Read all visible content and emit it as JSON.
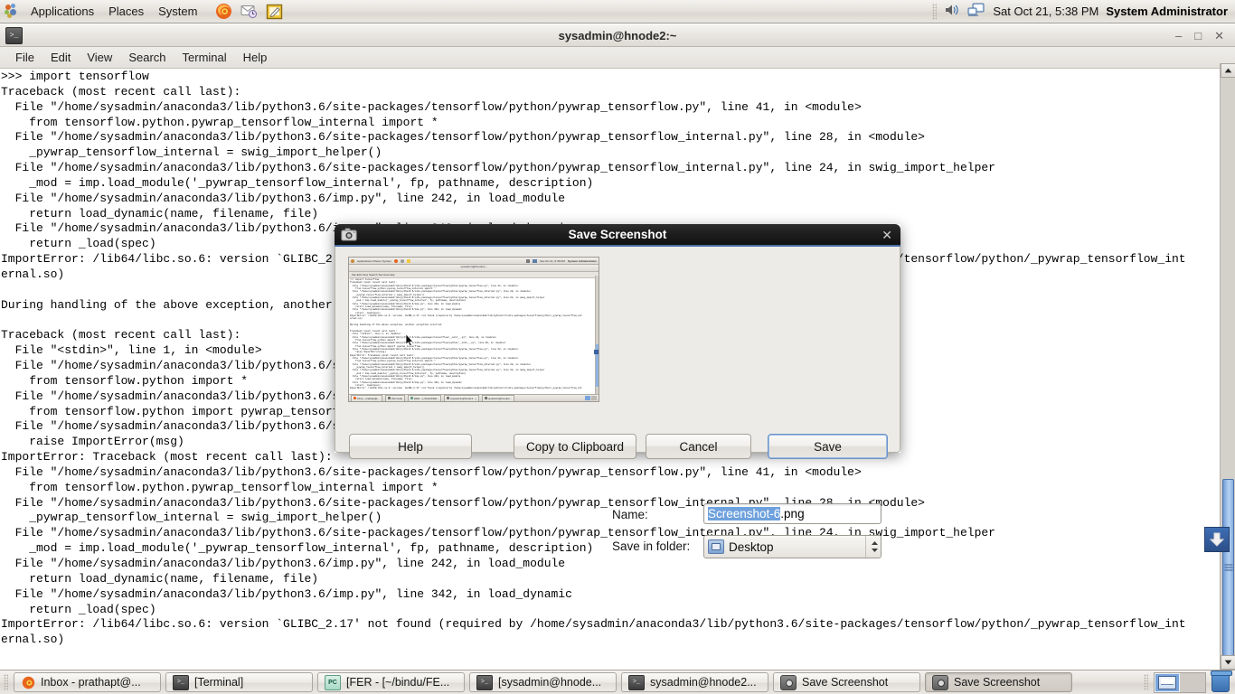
{
  "top_panel": {
    "menus": [
      "Applications",
      "Places",
      "System"
    ],
    "launchers": [
      {
        "name": "firefox-icon",
        "title": "Firefox Web Browser"
      },
      {
        "name": "evolution-mail-icon",
        "title": "Evolution Mail"
      },
      {
        "name": "text-editor-icon",
        "title": "Text Editor"
      }
    ],
    "tray": [
      {
        "name": "volume-icon"
      },
      {
        "name": "network-icon"
      }
    ],
    "clock": "Sat Oct 21,  5:38 PM",
    "user": "System Administrator"
  },
  "terminal": {
    "title": "sysadmin@hnode2:~",
    "menus": [
      "File",
      "Edit",
      "View",
      "Search",
      "Terminal",
      "Help"
    ],
    "window_buttons": {
      "minimize": "–",
      "maximize": "□",
      "close": "✕"
    },
    "content": ">>> import tensorflow\nTraceback (most recent call last):\n  File \"/home/sysadmin/anaconda3/lib/python3.6/site-packages/tensorflow/python/pywrap_tensorflow.py\", line 41, in <module>\n    from tensorflow.python.pywrap_tensorflow_internal import *\n  File \"/home/sysadmin/anaconda3/lib/python3.6/site-packages/tensorflow/python/pywrap_tensorflow_internal.py\", line 28, in <module>\n    _pywrap_tensorflow_internal = swig_import_helper()\n  File \"/home/sysadmin/anaconda3/lib/python3.6/site-packages/tensorflow/python/pywrap_tensorflow_internal.py\", line 24, in swig_import_helper\n    _mod = imp.load_module('_pywrap_tensorflow_internal', fp, pathname, description)\n  File \"/home/sysadmin/anaconda3/lib/python3.6/imp.py\", line 242, in load_module\n    return load_dynamic(name, filename, file)\n  File \"/home/sysadmin/anaconda3/lib/python3.6/imp.py\", line 342, in load_dynamic\n    return _load(spec)\nImportError: /lib64/libc.so.6: version `GLIBC_2.17' not found (required by /home/sysadmin/anaconda3/lib/python3.6/site-packages/tensorflow/python/_pywrap_tensorflow_int\nernal.so)\n\nDuring handling of the above exception, another exception occurred:\n\nTraceback (most recent call last):\n  File \"<stdin>\", line 1, in <module>\n  File \"/home/sysadmin/anaconda3/lib/python3.6/site-packages/tensorflow/__init__.py\", line 24, in <module>\n    from tensorflow.python import *\n  File \"/home/sysadmin/anaconda3/lib/python3.6/site-packages/tensorflow/python/__init__.py\", line 49, in <module>\n    from tensorflow.python import pywrap_tensorflow\n  File \"/home/sysadmin/anaconda3/lib/python3.6/site-packages/tensorflow/python/pywrap_tensorflow.py\", line 52, in <module>\n    raise ImportError(msg)\nImportError: Traceback (most recent call last):\n  File \"/home/sysadmin/anaconda3/lib/python3.6/site-packages/tensorflow/python/pywrap_tensorflow.py\", line 41, in <module>\n    from tensorflow.python.pywrap_tensorflow_internal import *\n  File \"/home/sysadmin/anaconda3/lib/python3.6/site-packages/tensorflow/python/pywrap_tensorflow_internal.py\", line 28, in <module>\n    _pywrap_tensorflow_internal = swig_import_helper()\n  File \"/home/sysadmin/anaconda3/lib/python3.6/site-packages/tensorflow/python/pywrap_tensorflow_internal.py\", line 24, in swig_import_helper\n    _mod = imp.load_module('_pywrap_tensorflow_internal', fp, pathname, description)\n  File \"/home/sysadmin/anaconda3/lib/python3.6/imp.py\", line 242, in load_module\n    return load_dynamic(name, filename, file)\n  File \"/home/sysadmin/anaconda3/lib/python3.6/imp.py\", line 342, in load_dynamic\n    return _load(spec)\nImportError: /lib64/libc.so.6: version `GLIBC_2.17' not found (required by /home/sysadmin/anaconda3/lib/python3.6/site-packages/tensorflow/python/_pywrap_tensorflow_int\nernal.so)"
  },
  "dialog": {
    "title": "Save Screenshot",
    "icon": "camera-icon",
    "close_label": "✕",
    "name_label": "Name:",
    "name_value_selected": "Screenshot-6",
    "name_value_rest": ".png",
    "folder_label": "Save in folder:",
    "folder_value": "Desktop",
    "buttons": {
      "help": "Help",
      "copy_to_clipboard": "Copy to Clipboard",
      "cancel": "Cancel",
      "save": "Save"
    },
    "preview": {
      "panel_menus": "Applications  Places  System",
      "panel_clock": "Sat Oct 21,  5:38 PM",
      "panel_user": "System Administrator",
      "window_title": "sysadmin@hnode2:~",
      "menus": "File  Edit  View  Search  Terminal  Help",
      "terminal_text": ">>> import tensorflow\nTraceback (most recent call last):\n  File \"/home/sysadmin/anaconda3/lib/python3.6/site-packages/tensorflow/python/pywrap_tensorflow.py\", line 41, in <module>\n    from tensorflow.python.pywrap_tensorflow_internal import *\n  File \"/home/sysadmin/anaconda3/lib/python3.6/site-packages/tensorflow/python/pywrap_tensorflow_internal.py\", line 28, in <module>\n    _pywrap_tensorflow_internal = swig_import_helper()\n  File \"/home/sysadmin/anaconda3/lib/python3.6/site-packages/tensorflow/python/pywrap_tensorflow_internal.py\", line 24, in swig_import_helper\n    _mod = imp.load_module('_pywrap_tensorflow_internal', fp, pathname, description)\n  File \"/home/sysadmin/anaconda3/lib/python3.6/imp.py\", line 242, in load_module\n    return load_dynamic(name, filename, file)\n  File \"/home/sysadmin/anaconda3/lib/python3.6/imp.py\", line 342, in load_dynamic\n    return _load(spec)\nImportError: /lib64/libc.so.6: version `GLIBC_2.17' not found (required by /home/sysadmin/anaconda3/lib/python3.6/site-packages/tensorflow/python/_pywrap_tensorflow_int\nernal.so)\n\nDuring handling of the above exception, another exception occurred:\n\nTraceback (most recent call last):\n  File \"<stdin>\", line 1, in <module>\n  File \"/home/sysadmin/anaconda3/lib/python3.6/site-packages/tensorflow/__init__.py\", line 24, in <module>\n    from tensorflow.python import *\n  File \"/home/sysadmin/anaconda3/lib/python3.6/site-packages/tensorflow/python/__init__.py\", line 49, in <module>\n    from tensorflow.python import pywrap_tensorflow\n  File \"/home/sysadmin/anaconda3/lib/python3.6/site-packages/tensorflow/python/pywrap_tensorflow.py\", line 52, in <module>\n    raise ImportError(msg)\nImportError: Traceback (most recent call last):\n  File \"/home/sysadmin/anaconda3/lib/python3.6/site-packages/tensorflow/python/pywrap_tensorflow.py\", line 41, in <module>\n    from tensorflow.python.pywrap_tensorflow_internal import *\n  File \"/home/sysadmin/anaconda3/lib/python3.6/site-packages/tensorflow/python/pywrap_tensorflow_internal.py\", line 28, in <module>\n    _pywrap_tensorflow_internal = swig_import_helper()\n  File \"/home/sysadmin/anaconda3/lib/python3.6/site-packages/tensorflow/python/pywrap_tensorflow_internal.py\", line 24, in swig_import_helper\n    _mod = imp.load_module('_pywrap_tensorflow_internal', fp, pathname, description)\n  File \"/home/sysadmin/anaconda3/lib/python3.6/imp.py\", line 242, in load_module\n    return load_dynamic(name, filename, file)\n  File \"/home/sysadmin/anaconda3/lib/python3.6/imp.py\", line 342, in load_dynamic\n    return _load(spec)\nImportError: /lib64/libc.so.6: version `GLIBC_2.17' not found (required by /home/sysadmin/anaconda3/lib/python3.6/site-packages/tensorflow/python/_pywrap_tensorflow_int\nernal.so)",
      "taskbar": [
        "Inbox - prathapt@...",
        "[Terminal]",
        "[FER - [~/bindu/FER...",
        "[sysadmin@hnode1 - ]",
        "sysadmin@hnode2..."
      ]
    }
  },
  "taskbar": {
    "items": [
      {
        "label": "Inbox - prathapt@...",
        "icon": "firefox-icon",
        "active": false
      },
      {
        "label": "[Terminal]",
        "icon": "terminal-icon",
        "active": false
      },
      {
        "label": "[FER - [~/bindu/FE...",
        "icon": "pycharm-icon",
        "active": false
      },
      {
        "label": "[sysadmin@hnode...",
        "icon": "terminal-icon",
        "active": false
      },
      {
        "label": "sysadmin@hnode2...",
        "icon": "terminal-icon",
        "active": false
      },
      {
        "label": "Save Screenshot",
        "icon": "camera-icon",
        "active": false
      },
      {
        "label": "Save Screenshot",
        "icon": "camera-icon",
        "active": true
      }
    ],
    "workspaces": [
      {
        "name": "workspace-1",
        "active": true
      },
      {
        "name": "workspace-2",
        "active": false
      }
    ],
    "trash": "trash-icon"
  },
  "colors": {
    "selection_blue": "#6ea1dd",
    "panel_bg": "#e6e3dd",
    "dialog_titlebar": "#1d1d1d",
    "accent_border": "#4a6fa5",
    "scrollbar_thumb": "#9dc0ea"
  }
}
